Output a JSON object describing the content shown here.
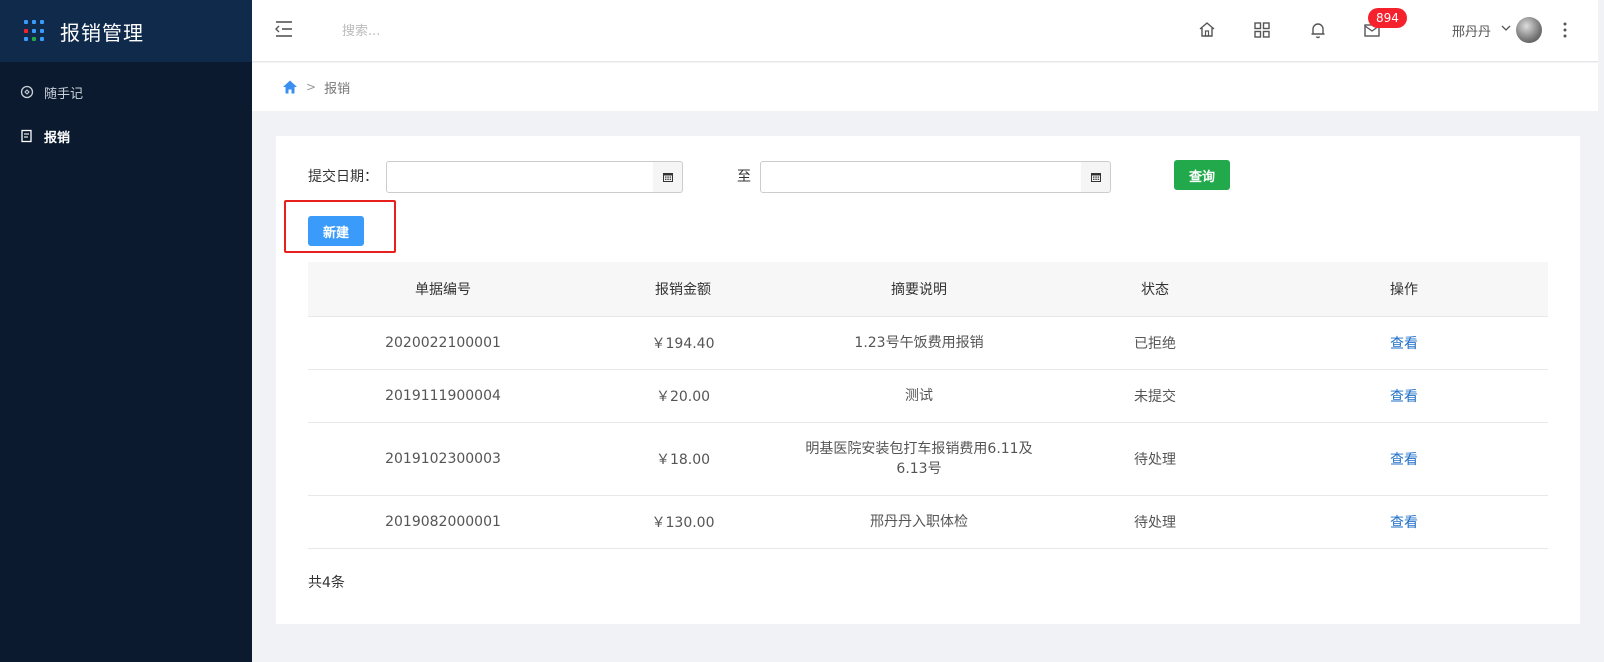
{
  "app": {
    "title": "报销管理"
  },
  "sidebar": {
    "items": [
      {
        "label": "随手记",
        "icon": "notebook-icon",
        "active": false
      },
      {
        "label": "报销",
        "icon": "receipt-icon",
        "active": true
      }
    ]
  },
  "header": {
    "search_placeholder": "搜索...",
    "badge_count": "894",
    "username": "邢丹丹"
  },
  "breadcrumb": {
    "separator": ">",
    "current": "报销"
  },
  "filter": {
    "date_label": "提交日期：",
    "start_value": "",
    "to_label": "至",
    "end_value": "",
    "query_button": "查询",
    "new_button": "新建"
  },
  "table": {
    "headers": [
      "单据编号",
      "报销金额",
      "摘要说明",
      "状态",
      "操作"
    ],
    "rows": [
      {
        "id": "2020022100001",
        "amount": "￥194.40",
        "summary": "1.23号午饭费用报销",
        "status": "已拒绝",
        "action": "查看"
      },
      {
        "id": "2019111900004",
        "amount": "￥20.00",
        "summary": "测试",
        "status": "未提交",
        "action": "查看"
      },
      {
        "id": "2019102300003",
        "amount": "￥18.00",
        "summary": "明基医院安装包打车报销费用6.11及6.13号",
        "status": "待处理",
        "action": "查看"
      },
      {
        "id": "2019082000001",
        "amount": "￥130.00",
        "summary": "邢丹丹入职体检",
        "status": "待处理",
        "action": "查看"
      }
    ]
  },
  "pagination": {
    "total": "共4条"
  },
  "colors": {
    "sidebar_bg": "#0b1a2e",
    "brand_bg": "#0f2a4a",
    "query_green": "#21a94b",
    "new_blue": "#3b9bfb",
    "badge_red": "#f5222d",
    "highlight_red": "#e8201d",
    "link_blue": "#1f6fc7"
  }
}
